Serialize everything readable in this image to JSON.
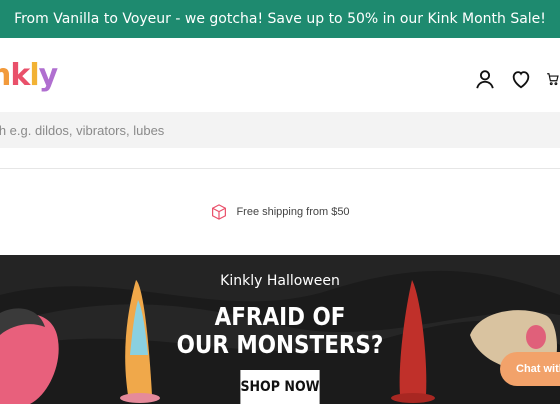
{
  "promo": {
    "text": "From Vanilla to Voyeur - we gotcha! Save up to 50% in our Kink Month Sale!"
  },
  "header": {
    "logo_parts": [
      "n",
      "k",
      "l",
      "y"
    ],
    "icons": [
      "account-icon",
      "wishlist-heart-icon",
      "cart-icon"
    ]
  },
  "search": {
    "placeholder": "rch e.g. dildos, vibrators, lubes"
  },
  "shipping": {
    "text": "Free shipping from $50",
    "icon": "box-icon"
  },
  "banner": {
    "subtitle": "Kinkly Halloween",
    "title_line1": "AFRAID OF",
    "title_line2": "OUR MONSTERS?",
    "button_label": "SHOP NOW"
  },
  "chat": {
    "label": "Chat with"
  },
  "colors": {
    "promo_bg": "#1e8a6f",
    "banner_bg": "#1b1b1b",
    "chat_bg": "#f2a26a",
    "shipping_icon": "#e9506a"
  }
}
